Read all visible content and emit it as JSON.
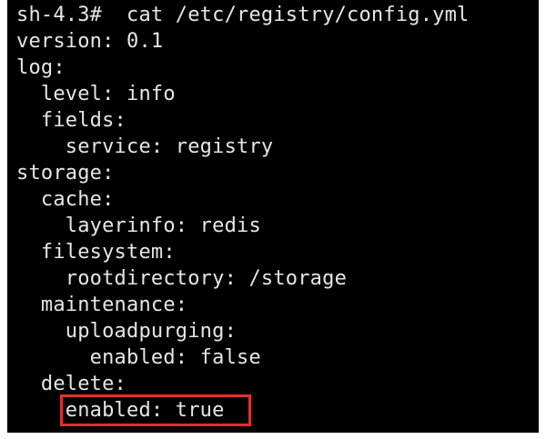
{
  "terminal": {
    "prompt": "sh-4.3#",
    "command": "cat /etc/registry/config.yml",
    "lines": [
      "version: 0.1",
      "log:",
      "  level: info",
      "  fields:",
      "    service: registry",
      "storage:",
      "  cache:",
      "    layerinfo: redis",
      "  filesystem:",
      "    rootdirectory: /storage",
      "  maintenance:",
      "    uploadpurging:",
      "      enabled: false",
      "  delete:",
      "    enabled: true"
    ],
    "highlight_color": "#e03030"
  }
}
